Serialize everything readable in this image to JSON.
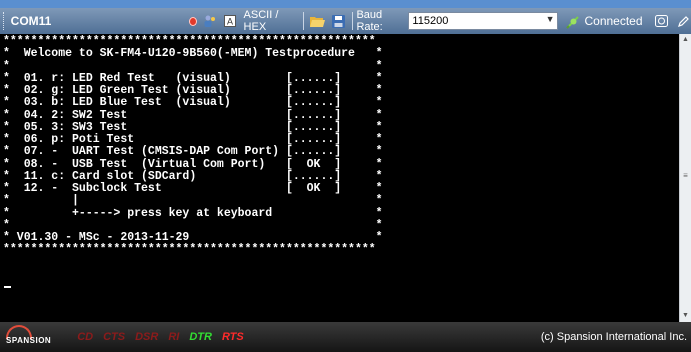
{
  "toolbar": {
    "port": "COM11",
    "ascii_hex_label": "ASCII / HEX",
    "baud_label": "Baud Rate:",
    "baud_value": "115200",
    "status": "Connected"
  },
  "terminal": {
    "lines": [
      "******************************************************",
      "*  Welcome to SK-FM4-U120-9B560(-MEM) Testprocedure   *",
      "*                                                     *",
      "*  01. r: LED Red Test   (visual)        [......]     *",
      "*  02. g: LED Green Test (visual)        [......]     *",
      "*  03. b: LED Blue Test  (visual)        [......]     *",
      "*  04. 2: SW2 Test                       [......]     *",
      "*  05. 3: SW3 Test                       [......]     *",
      "*  06. p: Poti Test                      [......]     *",
      "*  07. -  UART Test (CMSIS-DAP Com Port) [......]     *",
      "*  08. -  USB Test  (Virtual Com Port)   [  OK  ]     *",
      "*  11. c: Card slot (SDCard)             [......]     *",
      "*  12. -  Subclock Test                  [  OK  ]     *",
      "*         |                                           *",
      "*         +-----> press key at keyboard               *",
      "*                                                     *",
      "* V01.30 - MSc - 2013-11-29                           *",
      "******************************************************"
    ]
  },
  "footer": {
    "logo": "SPANSION",
    "signals": [
      {
        "label": "CD",
        "color": "#8c1b1b"
      },
      {
        "label": "CTS",
        "color": "#8c1b1b"
      },
      {
        "label": "DSR",
        "color": "#8c1b1b"
      },
      {
        "label": "RI",
        "color": "#8c1b1b"
      },
      {
        "label": "DTR",
        "color": "#33dd33"
      },
      {
        "label": "RTS",
        "color": "#ff2a2a"
      }
    ],
    "copyright": "(c) Spansion International Inc."
  }
}
